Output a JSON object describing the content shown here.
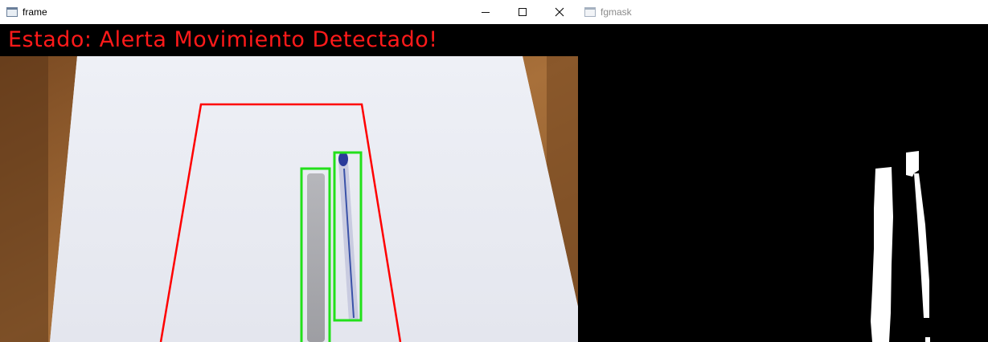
{
  "frame_window": {
    "title": "frame",
    "icon": "window-app-icon",
    "controls": {
      "minimize": "minimize-icon",
      "maximize": "maximize-icon",
      "close": "close-icon"
    },
    "status_text": "Estado: Alerta Movimiento Detectado!",
    "colors": {
      "status_text": "#ff1a1a",
      "detection_box": "#22e01a",
      "zone_outline": "#ff0000"
    }
  },
  "mask_window": {
    "title": "fgmask",
    "icon": "window-app-icon"
  }
}
